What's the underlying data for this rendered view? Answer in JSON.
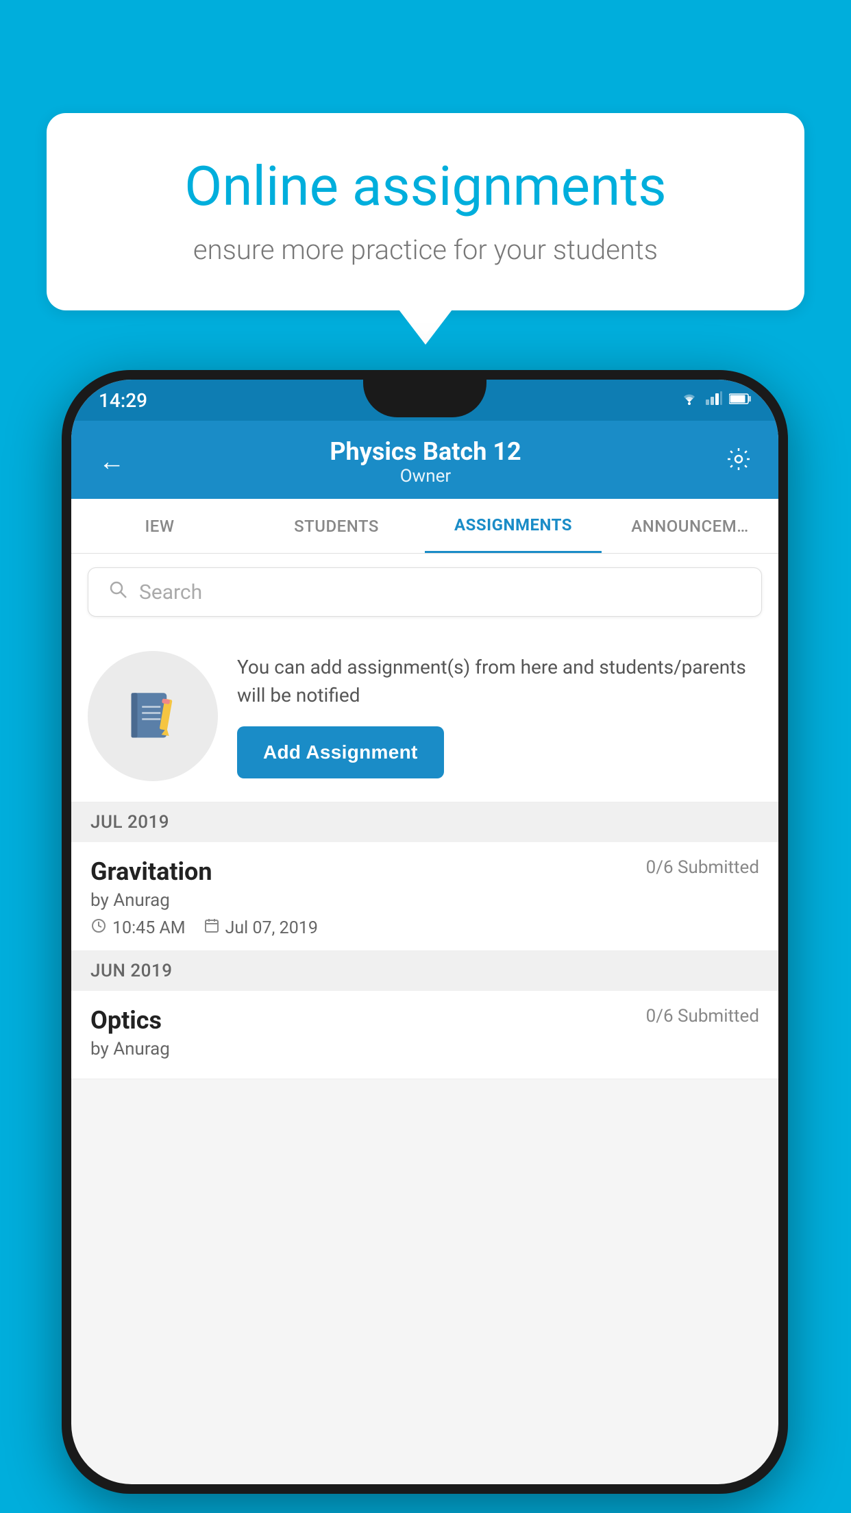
{
  "background_color": "#00AEDC",
  "speech_bubble": {
    "title": "Online assignments",
    "subtitle": "ensure more practice for your students"
  },
  "phone": {
    "status_bar": {
      "time": "14:29",
      "icons": [
        "wifi",
        "signal",
        "battery"
      ]
    },
    "header": {
      "title": "Physics Batch 12",
      "subtitle": "Owner",
      "back_label": "←",
      "settings_label": "⚙"
    },
    "tabs": [
      {
        "label": "IEW",
        "active": false
      },
      {
        "label": "STUDENTS",
        "active": false
      },
      {
        "label": "ASSIGNMENTS",
        "active": true
      },
      {
        "label": "ANNOUNCEM…",
        "active": false
      }
    ],
    "search": {
      "placeholder": "Search"
    },
    "assignment_prompt": {
      "description": "You can add assignment(s) from here and students/parents will be notified",
      "button_label": "Add Assignment"
    },
    "sections": [
      {
        "header": "JUL 2019",
        "assignments": [
          {
            "name": "Gravitation",
            "submitted": "0/6 Submitted",
            "author": "by Anurag",
            "time": "10:45 AM",
            "date": "Jul 07, 2019"
          }
        ]
      },
      {
        "header": "JUN 2019",
        "assignments": [
          {
            "name": "Optics",
            "submitted": "0/6 Submitted",
            "author": "by Anurag",
            "time": "",
            "date": ""
          }
        ]
      }
    ]
  }
}
